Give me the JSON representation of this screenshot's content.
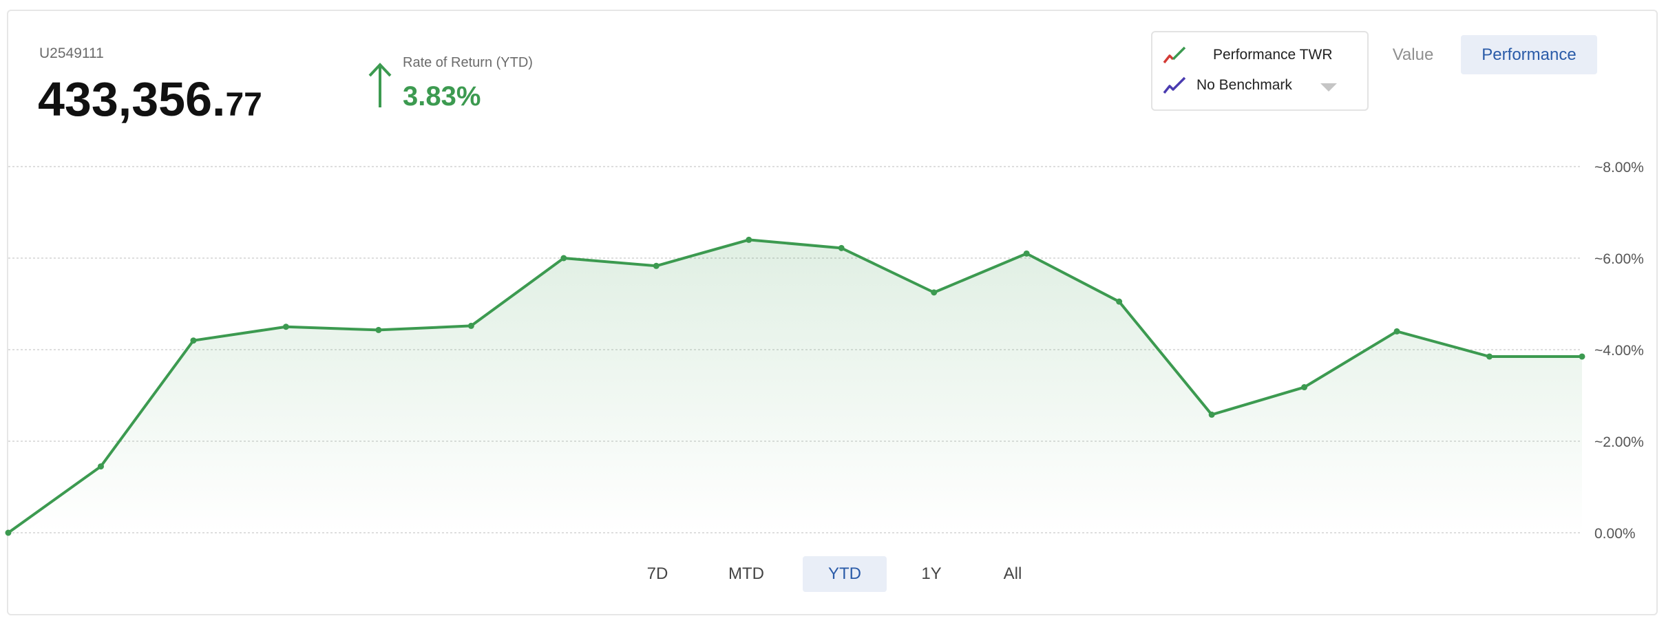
{
  "account": {
    "id": "U2549111",
    "value_main": "433,356.",
    "value_cents": "77"
  },
  "rate_of_return": {
    "label": "Rate of Return (YTD)",
    "value": "3.83%",
    "direction_icon": "arrow-up-icon",
    "color": "#3c9a50"
  },
  "legend": {
    "series_label": "Performance TWR",
    "series_icon": "performance-line-icon",
    "benchmark_label": "No Benchmark",
    "benchmark_icon": "benchmark-line-icon"
  },
  "view_toggle": {
    "value_label": "Value",
    "performance_label": "Performance",
    "active": "Performance"
  },
  "ranges": [
    {
      "label": "7D",
      "active": false
    },
    {
      "label": "MTD",
      "active": false
    },
    {
      "label": "YTD",
      "active": true
    },
    {
      "label": "1Y",
      "active": false
    },
    {
      "label": "All",
      "active": false
    }
  ],
  "chart_data": {
    "type": "area",
    "series": [
      {
        "name": "Performance TWR",
        "color": "#3c9a50",
        "values": [
          0.0,
          1.45,
          4.2,
          4.5,
          4.43,
          4.52,
          6.0,
          5.83,
          6.4,
          6.22,
          5.25,
          6.1,
          5.05,
          2.58,
          3.18,
          4.4,
          3.85,
          3.85
        ]
      }
    ],
    "ylim": [
      0,
      8
    ],
    "y_ticks": [
      "0.00%",
      "~2.00%",
      "~4.00%",
      "~6.00%",
      "~8.00%"
    ],
    "y_tick_values": [
      0,
      2,
      4,
      6,
      8
    ],
    "grid": true,
    "y_axis_position": "right"
  }
}
